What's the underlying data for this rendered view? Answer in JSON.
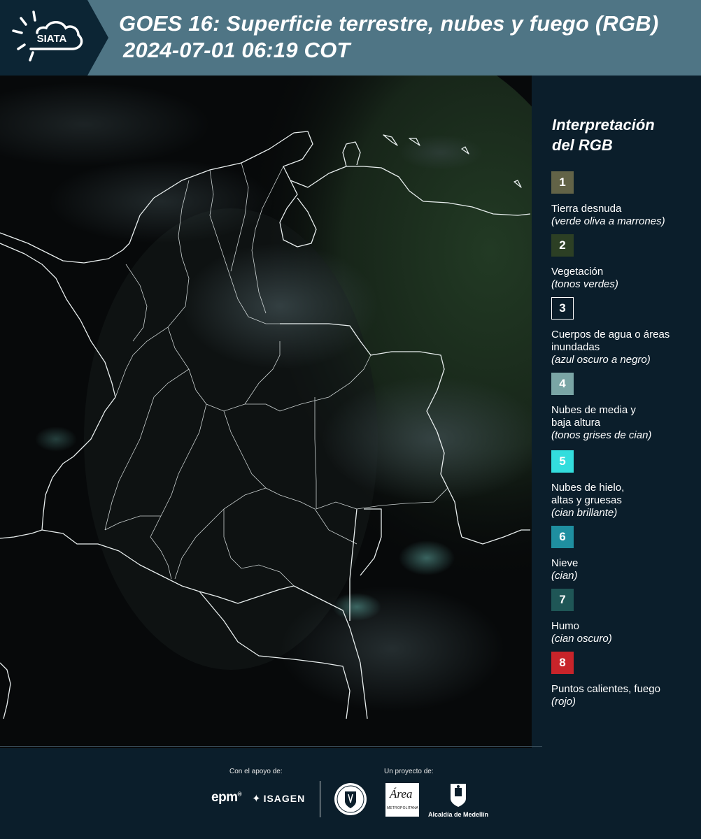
{
  "header": {
    "logo_text": "SIATA",
    "title_line1": "GOES 16: Superficie terrestre, nubes y fuego (RGB)",
    "title_line2": "2024-07-01 06:19 COT"
  },
  "legend": {
    "title_line1": "Interpretación",
    "title_line2": "del RGB",
    "items": [
      {
        "number": "1",
        "label": "Tierra desnuda",
        "note": "(verde oliva a marrones)",
        "color": "#626347"
      },
      {
        "number": "2",
        "label": "Vegetación",
        "note": "(tonos verdes)",
        "color": "#2c3f24"
      },
      {
        "number": "3",
        "label": "Cuerpos de agua o áreas inundadas",
        "note": "(azul oscuro a negro)",
        "color": "#0b1e2b"
      },
      {
        "number": "4",
        "label": "Nubes de media y baja altura",
        "note": "(tonos grises de cian)",
        "color": "#7aa5a5"
      },
      {
        "number": "5",
        "label": "Nubes de hielo, altas y gruesas",
        "note": "(cian brillante)",
        "color": "#33dddd"
      },
      {
        "number": "6",
        "label": "Nieve",
        "note": "(cian)",
        "color": "#1f8fa0"
      },
      {
        "number": "7",
        "label": "Humo",
        "note": "(cian oscuro)",
        "color": "#1f5656"
      },
      {
        "number": "8",
        "label": "Puntos calientes, fuego",
        "note": "(rojo)",
        "color": "#c8242a"
      }
    ]
  },
  "footer": {
    "support_label": "Con el apoyo de:",
    "project_label": "Un proyecto de:",
    "epm": "epm",
    "epm_mark": "®",
    "isagen": "ISAGEN",
    "area_logo": "Área",
    "area_sub": "METROPOLITANA",
    "alcaldia": "Alcaldía de Medellín"
  }
}
